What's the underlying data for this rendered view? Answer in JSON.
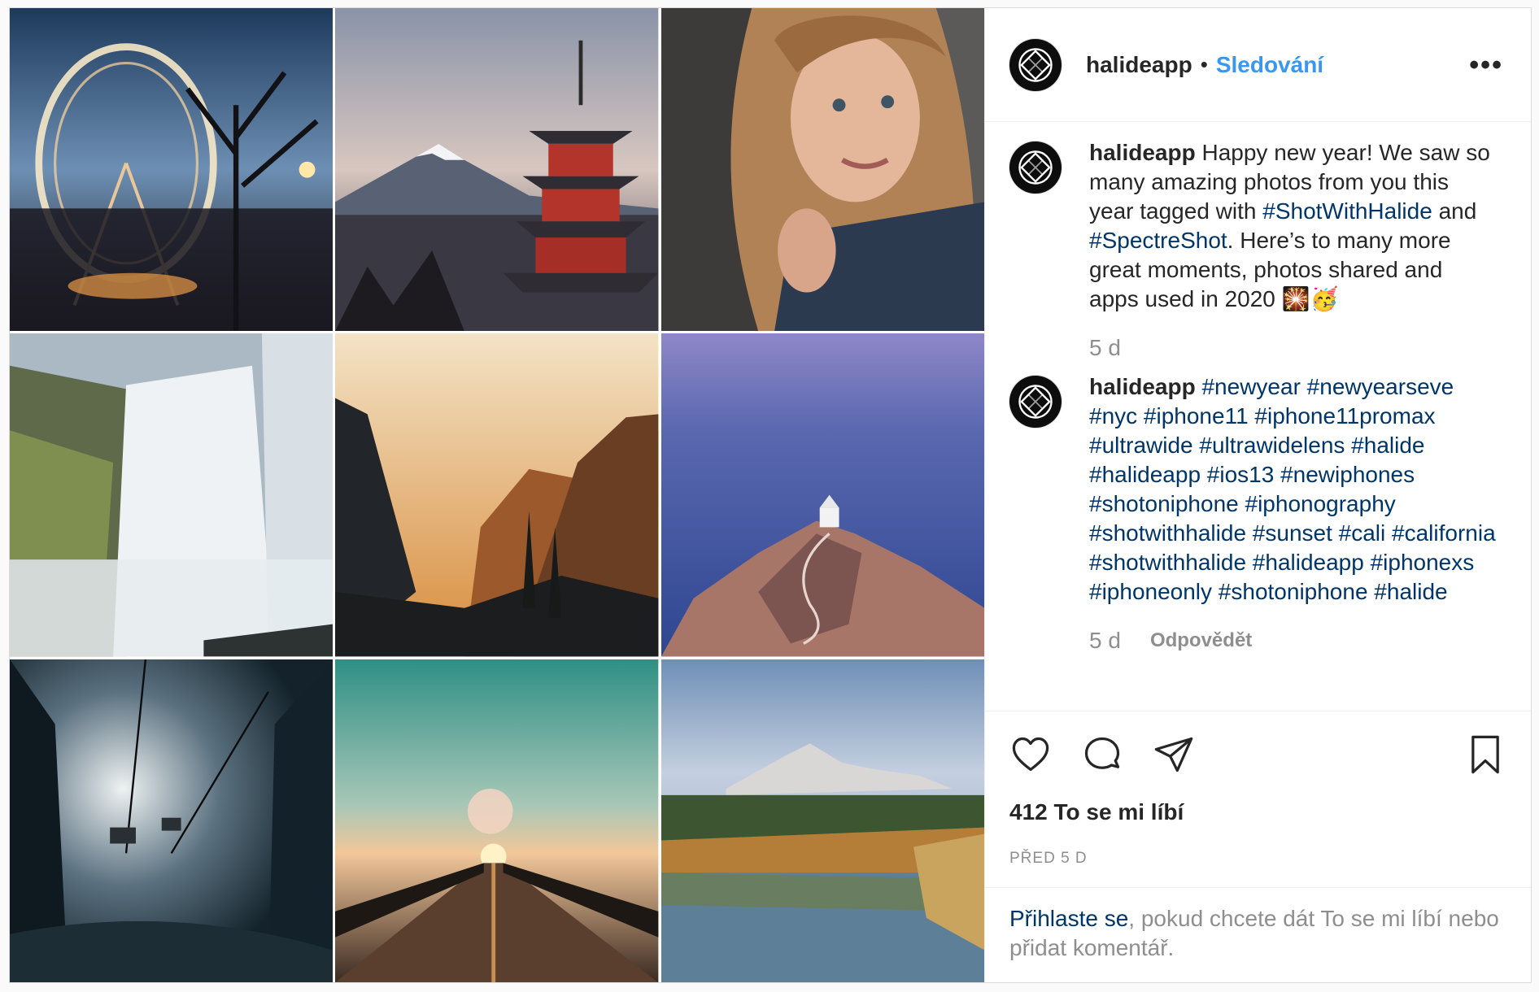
{
  "header": {
    "username": "halideapp",
    "separator": "•",
    "follow_label": "Sledování",
    "more_label": "•••"
  },
  "comments": [
    {
      "username": "halideapp",
      "text_parts": [
        {
          "type": "text",
          "value": " Happy new year! We saw so many amazing photos from you this year tagged with "
        },
        {
          "type": "tag",
          "value": "#ShotWithHalide"
        },
        {
          "type": "text",
          "value": " and "
        },
        {
          "type": "tag",
          "value": "#SpectreShot"
        },
        {
          "type": "text",
          "value": ". Here’s to many more great moments, photos shared and apps used in 2020 🎇🥳"
        }
      ],
      "time": "5 d"
    },
    {
      "username": "halideapp",
      "text_parts": [
        {
          "type": "text",
          "value": " "
        },
        {
          "type": "tag",
          "value": "#newyear #newyearseve #nyc #iphone11 #iphone11promax #ultrawide #ultrawidelens #halide #halideapp #ios13 #newiphones #shotoniphone #iphonography #shotwithhalide #sunset #cali #california #shotwithhalide #halideapp #iphonexs #iphoneonly #shotoniphone #halide"
        }
      ],
      "time": "5 d",
      "reply_label": "Odpovědět"
    }
  ],
  "actions": {
    "like": "heart-icon",
    "comment": "comment-icon",
    "share": "share-icon",
    "save": "bookmark-icon"
  },
  "likes_text": "412 To se mi líbí",
  "posted_ago": "PŘED 5 D",
  "login_prompt": {
    "link": "Přihlaste se",
    "rest": ", pokud chcete dát To se mi líbí nebo přidat komentář."
  },
  "colors": {
    "accent": "#3897f0",
    "hashtag": "#003569",
    "muted": "#8e8e8e",
    "border": "#dbdbdb"
  }
}
